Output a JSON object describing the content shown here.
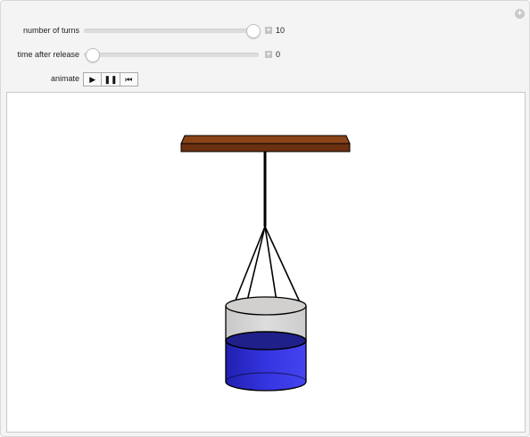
{
  "controls": {
    "turns_label": "number of turns",
    "turns_value": "10",
    "turns_fraction": 1.0,
    "time_label": "time after release",
    "time_value": "0",
    "time_fraction": 0.0,
    "animate_label": "animate"
  },
  "icons": {
    "corner": "plus-icon",
    "play": "play-icon",
    "pause": "pause-icon",
    "reset": "step-back-icon"
  },
  "colors": {
    "board": "#7a3a14",
    "water": "#2d2dd8",
    "bucket": "#d4d4d4"
  }
}
